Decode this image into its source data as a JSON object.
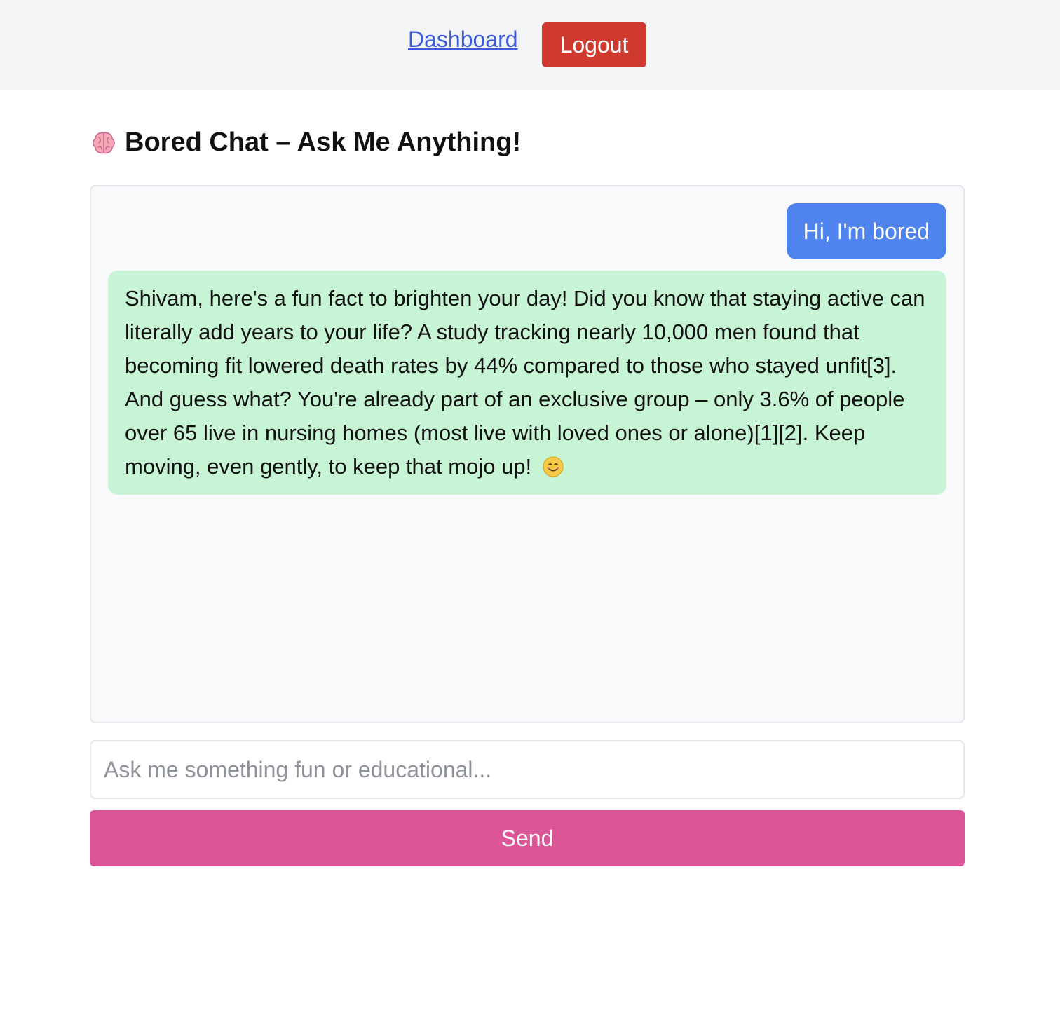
{
  "nav": {
    "dashboard_label": "Dashboard",
    "logout_label": "Logout"
  },
  "page": {
    "title": "Bored Chat – Ask Me Anything!",
    "title_icon": "brain-icon"
  },
  "chat": {
    "messages": [
      {
        "role": "user",
        "text": "Hi, I'm bored"
      },
      {
        "role": "assistant",
        "text": "Shivam, here's a fun fact to brighten your day! Did you know that staying active can literally add years to your life? A study tracking nearly 10,000 men found that becoming fit lowered death rates by 44% compared to those who stayed unfit[3]. And guess what? You're already part of an exclusive group – only 3.6% of people over 65 live in nursing homes (most live with loved ones or alone)[1][2]. Keep moving, even gently, to keep that mojo up!",
        "trailing_icon": "smiling-face-icon"
      }
    ]
  },
  "composer": {
    "value": "",
    "placeholder": "Ask me something fun or educational...",
    "send_label": "Send"
  },
  "colors": {
    "nav_bg": "#f3f4f6",
    "link": "#3b5bdb",
    "logout_bg": "#cf3a2f",
    "user_bubble": "#4f83ee",
    "bot_bubble": "#c7f4d4",
    "chat_bg": "#f8f9fb",
    "send_bg": "#db5597"
  }
}
